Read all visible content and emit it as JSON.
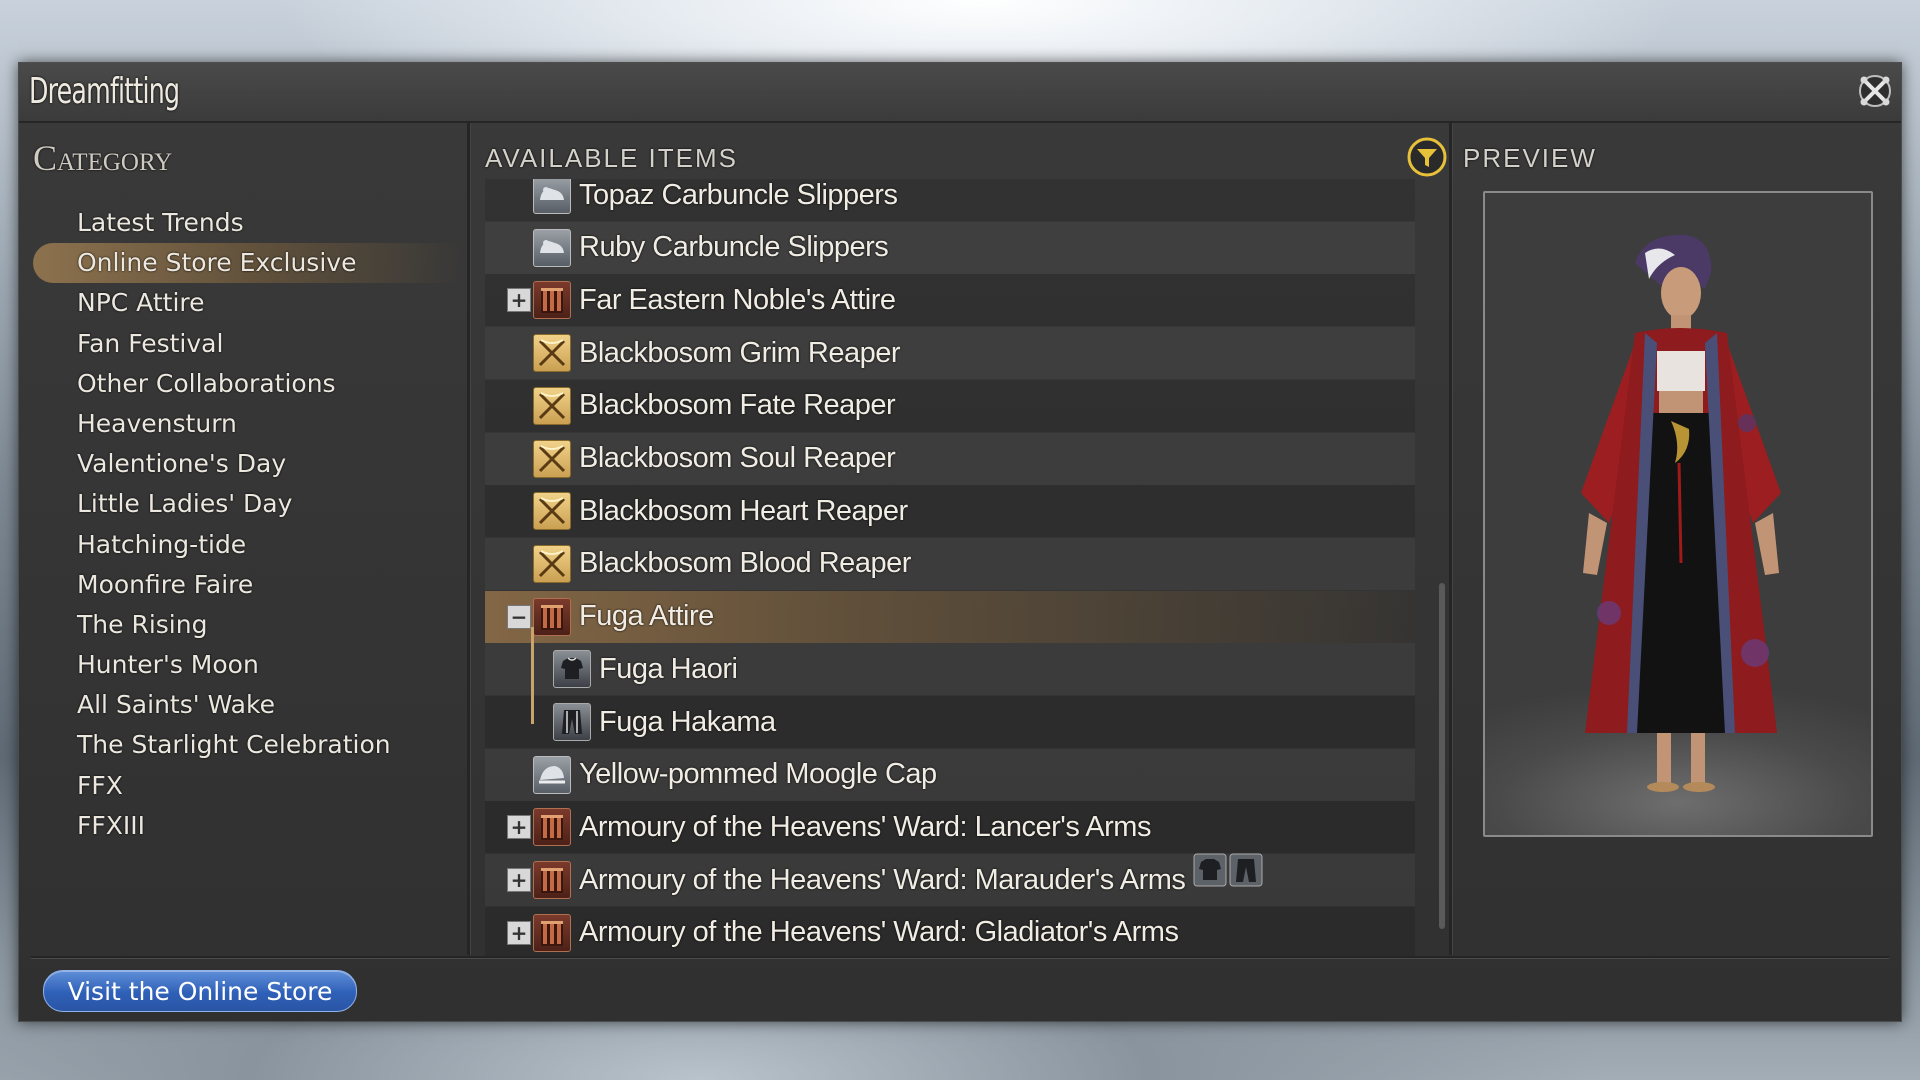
{
  "window": {
    "title": "Dreamfitting"
  },
  "category": {
    "heading": "Category",
    "items": [
      {
        "label": "Latest Trends",
        "selected": false
      },
      {
        "label": "Online Store Exclusive",
        "selected": true
      },
      {
        "label": "NPC Attire",
        "selected": false
      },
      {
        "label": "Fan Festival",
        "selected": false
      },
      {
        "label": "Other Collaborations",
        "selected": false
      },
      {
        "label": "Heavensturn",
        "selected": false
      },
      {
        "label": "Valentione's Day",
        "selected": false
      },
      {
        "label": "Little Ladies' Day",
        "selected": false
      },
      {
        "label": "Hatching-tide",
        "selected": false
      },
      {
        "label": "Moonfire Faire",
        "selected": false
      },
      {
        "label": "The Rising",
        "selected": false
      },
      {
        "label": "Hunter's Moon",
        "selected": false
      },
      {
        "label": "All Saints' Wake",
        "selected": false
      },
      {
        "label": "The Starlight Celebration",
        "selected": false
      },
      {
        "label": "FFX",
        "selected": false
      },
      {
        "label": "FFXIII",
        "selected": false
      }
    ]
  },
  "available": {
    "heading": "AVAILABLE ITEMS",
    "items": [
      {
        "label": "Topaz Carbuncle Slippers",
        "icon": "slippers-icon",
        "expander": "",
        "child": false,
        "selected": false
      },
      {
        "label": "Ruby Carbuncle Slippers",
        "icon": "slippers-icon",
        "expander": "",
        "child": false,
        "selected": false
      },
      {
        "label": "Far Eastern Noble's Attire",
        "icon": "gift-box-icon",
        "expander": "+",
        "child": false,
        "selected": false
      },
      {
        "label": "Blackbosom Grim Reaper",
        "icon": "scythe-icon",
        "expander": "",
        "child": false,
        "selected": false
      },
      {
        "label": "Blackbosom Fate Reaper",
        "icon": "scythe-icon",
        "expander": "",
        "child": false,
        "selected": false
      },
      {
        "label": "Blackbosom Soul Reaper",
        "icon": "scythe-icon",
        "expander": "",
        "child": false,
        "selected": false
      },
      {
        "label": "Blackbosom Heart Reaper",
        "icon": "scythe-icon",
        "expander": "",
        "child": false,
        "selected": false
      },
      {
        "label": "Blackbosom Blood Reaper",
        "icon": "scythe-icon",
        "expander": "",
        "child": false,
        "selected": false
      },
      {
        "label": "Fuga Attire",
        "icon": "gift-box-icon",
        "expander": "−",
        "child": false,
        "selected": true
      },
      {
        "label": "Fuga Haori",
        "icon": "body-armor-icon",
        "expander": "",
        "child": true,
        "selected": false
      },
      {
        "label": "Fuga Hakama",
        "icon": "legs-icon",
        "expander": "",
        "child": true,
        "selected": false
      },
      {
        "label": "Yellow-pommed Moogle Cap",
        "icon": "hat-icon",
        "expander": "",
        "child": false,
        "selected": false
      },
      {
        "label": "Armoury of the Heavens' Ward: Lancer's Arms",
        "icon": "gift-box-icon",
        "expander": "+",
        "child": false,
        "selected": false
      },
      {
        "label": "Armoury of the Heavens' Ward: Marauder's Arms",
        "icon": "gift-box-icon",
        "expander": "+",
        "child": false,
        "selected": false
      },
      {
        "label": "Armoury of the Heavens' Ward: Gladiator's Arms",
        "icon": "gift-box-icon",
        "expander": "+",
        "child": false,
        "selected": false
      }
    ]
  },
  "preview": {
    "heading": "PREVIEW",
    "slots": [
      {
        "icon": "body-armor-icon"
      },
      {
        "icon": "legs-icon"
      }
    ]
  },
  "footer": {
    "store_button": "Visit the Online Store"
  },
  "colors": {
    "selection": "#8a6a46",
    "accent_button": "#2f60b8",
    "filter_icon": "#e8c13a"
  }
}
